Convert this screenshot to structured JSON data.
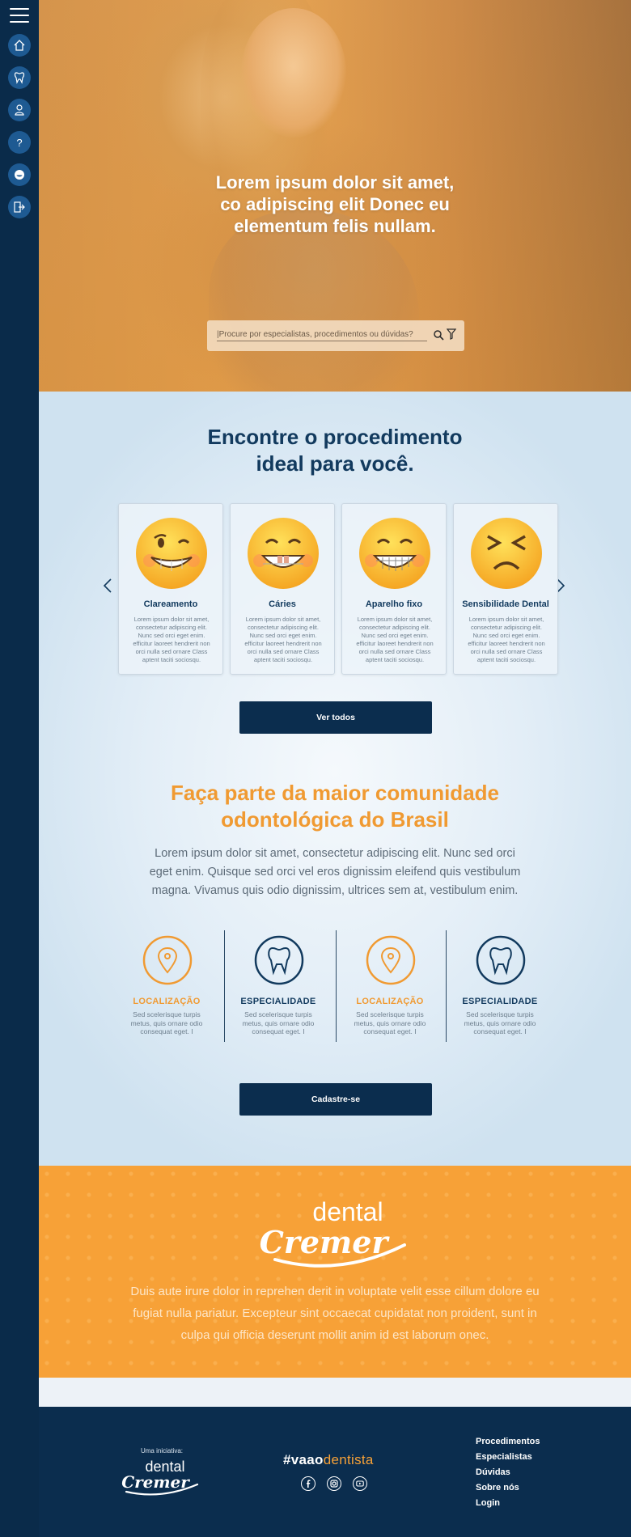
{
  "hero": {
    "title": "Lorem ipsum dolor sit amet,\nco  adipiscing elit Donec eu\nelementum felis nullam.",
    "search_placeholder": "|Procure por especialistas, procedimentos ou dúvidas?"
  },
  "sidebar": {
    "items": [
      {
        "icon": "home-icon"
      },
      {
        "icon": "tooth-icon"
      },
      {
        "icon": "dentist-icon"
      },
      {
        "icon": "question-icon"
      },
      {
        "icon": "smile-icon"
      },
      {
        "icon": "logout-icon"
      }
    ]
  },
  "procedures": {
    "title": "Encontre o procedimento\nideal para você.",
    "cards": [
      {
        "title": "Clareamento",
        "desc": "Lorem ipsum dolor sit amet, consectetur adipiscing elit. Nunc sed orci eget enim. efficitur laoreet hendrerit non orci nulla sed ornare Class aptent taciti sociosqu.",
        "emoji": "grimace-wink-emoji"
      },
      {
        "title": "Cáries",
        "desc": "Lorem ipsum dolor sit amet, consectetur adipiscing elit. Nunc sed orci eget enim. efficitur laoreet hendrerit non orci nulla sed ornare Class aptent taciti sociosqu.",
        "emoji": "grin-cavity-emoji"
      },
      {
        "title": "Aparelho fixo",
        "desc": "Lorem ipsum dolor sit amet, consectetur adipiscing elit. Nunc sed orci eget enim. efficitur laoreet hendrerit non orci nulla sed ornare Class aptent taciti sociosqu.",
        "emoji": "braces-grin-emoji"
      },
      {
        "title": "Sensibilidade Dental",
        "desc": "Lorem ipsum dolor sit amet, consectetur adipiscing elit. Nunc sed orci eget enim. efficitur laoreet hendrerit non orci nulla sed ornare Class aptent taciti sociosqu.",
        "emoji": "wince-emoji"
      }
    ],
    "button": "Ver todos"
  },
  "community": {
    "title": "Faça parte da maior comunidade\nodontológica do Brasil",
    "text": "Lorem ipsum dolor sit amet, consectetur adipiscing elit. Nunc sed orci eget enim. Quisque sed orci vel eros dignissim eleifend quis vestibulum magna. Vivamus quis odio dignissim, ultrices sem at, vestibulum enim.",
    "features": [
      {
        "title": "LOCALIZAÇÃO",
        "desc": "Sed scelerisque turpis metus, quis ornare odio consequat eget. I",
        "icon": "location-pin-icon",
        "color": "#f09a32"
      },
      {
        "title": "ESPECIALIDADE",
        "desc": "Sed scelerisque turpis metus, quis ornare odio consequat eget. I",
        "icon": "tooth-outline-icon",
        "color": "#123a5e"
      },
      {
        "title": "LOCALIZAÇÃO",
        "desc": "Sed scelerisque turpis metus, quis ornare odio consequat eget. I",
        "icon": "location-pin-icon",
        "color": "#f09a32"
      },
      {
        "title": "ESPECIALIDADE",
        "desc": "Sed scelerisque turpis metus, quis ornare odio consequat eget. I",
        "icon": "tooth-outline-icon",
        "color": "#123a5e"
      }
    ],
    "button": "Cadastre-se"
  },
  "brand": {
    "logo_top": "dental",
    "logo_script": "Cremer",
    "text": "Duis aute irure dolor in reprehen derit in voluptate velit esse cillum dolore eu fugiat nulla pariatur. Excepteur sint occaecat cupidatat non proident, sunt in culpa qui officia deserunt mollit anim id est laborum onec."
  },
  "footer": {
    "initiative": "Uma iniciativa:",
    "logo_top": "dental",
    "logo_script": "Cremer",
    "hashtag_part1": "#vaao",
    "hashtag_part2": "dentista",
    "socials": [
      "facebook-icon",
      "instagram-icon",
      "youtube-icon"
    ],
    "links": [
      "Procedimentos",
      "Especialistas",
      "Dúvidas",
      "Sobre nós",
      "Login"
    ]
  },
  "colors": {
    "navy": "#0b2d4e",
    "orange": "#f7a137",
    "title_navy": "#123a5e",
    "title_orange": "#f09a32"
  }
}
